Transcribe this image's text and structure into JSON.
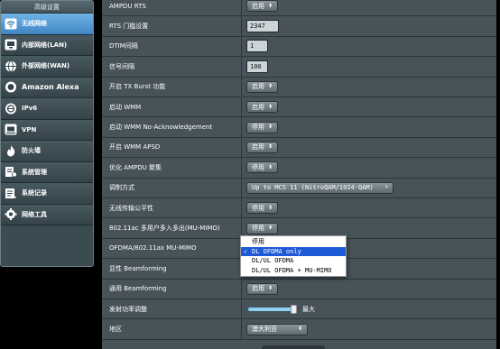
{
  "sidebar": {
    "title": "高级设置",
    "items": [
      {
        "label": "无线网络",
        "icon": "wifi-icon",
        "active": true
      },
      {
        "label": "内部网络(LAN)",
        "icon": "lan-icon"
      },
      {
        "label": "外部网络(WAN)",
        "icon": "globe-icon"
      },
      {
        "label": "Amazon Alexa",
        "icon": "alexa-icon"
      },
      {
        "label": "IPv6",
        "icon": "ipv6-icon"
      },
      {
        "label": "VPN",
        "icon": "vpn-icon"
      },
      {
        "label": "防火墙",
        "icon": "firewall-icon"
      },
      {
        "label": "系统管理",
        "icon": "admin-gear-icon"
      },
      {
        "label": "系统记录",
        "icon": "log-icon"
      },
      {
        "label": "网络工具",
        "icon": "tools-icon"
      }
    ]
  },
  "settings": [
    {
      "label": "AMPDU RTS",
      "type": "select",
      "value": "启用"
    },
    {
      "label": "RTS 门槛设置",
      "type": "input",
      "value": "2347"
    },
    {
      "label": "DTIM间隔",
      "type": "input",
      "value": "1"
    },
    {
      "label": "信号间隔",
      "type": "input",
      "value": "100"
    },
    {
      "label": "开启 TX Burst 功能",
      "type": "select",
      "value": "启用"
    },
    {
      "label": "启动 WMM",
      "type": "select",
      "value": "启用"
    },
    {
      "label": "启动 WMM No-Acknowledgement",
      "type": "select",
      "value": "停用"
    },
    {
      "label": "开启 WMM APSD",
      "type": "select",
      "value": "启用"
    },
    {
      "label": "优化 AMPDU 聚集",
      "type": "select",
      "value": "停用"
    },
    {
      "label": "调制方式",
      "type": "select",
      "value": "Up to MCS 11 (NitroQAM/1024-QAM)"
    },
    {
      "label": "无线传输公平性",
      "type": "select",
      "value": "停用"
    },
    {
      "label": "802.11ac 多用户多入多出(MU-MIMO)",
      "type": "select",
      "value": "停用"
    },
    {
      "label": "OFDMA/802.11ax MU-MIMO",
      "type": "select",
      "value": ""
    },
    {
      "label": "显性 Beamforming",
      "type": "select",
      "value": ""
    },
    {
      "label": "通用 Beamforming",
      "type": "select",
      "value": "启用"
    },
    {
      "label": "发射功率调整",
      "type": "slider",
      "value": "最大",
      "level": 1.0
    },
    {
      "label": "地区",
      "type": "select",
      "value": "澳大利亚"
    }
  ],
  "ofdma_dropdown": {
    "options": [
      "停用",
      "DL OFDMA only",
      "DL/UL OFDMA",
      "DL/UL OFDMA + MU-MIMO"
    ],
    "selected_index": 1,
    "check_mark": "✓"
  },
  "colors": {
    "accent": "#3f86c4",
    "selected_option": "#1e5ad6",
    "panel": "#475359",
    "sidebar": "#3b4b52"
  }
}
